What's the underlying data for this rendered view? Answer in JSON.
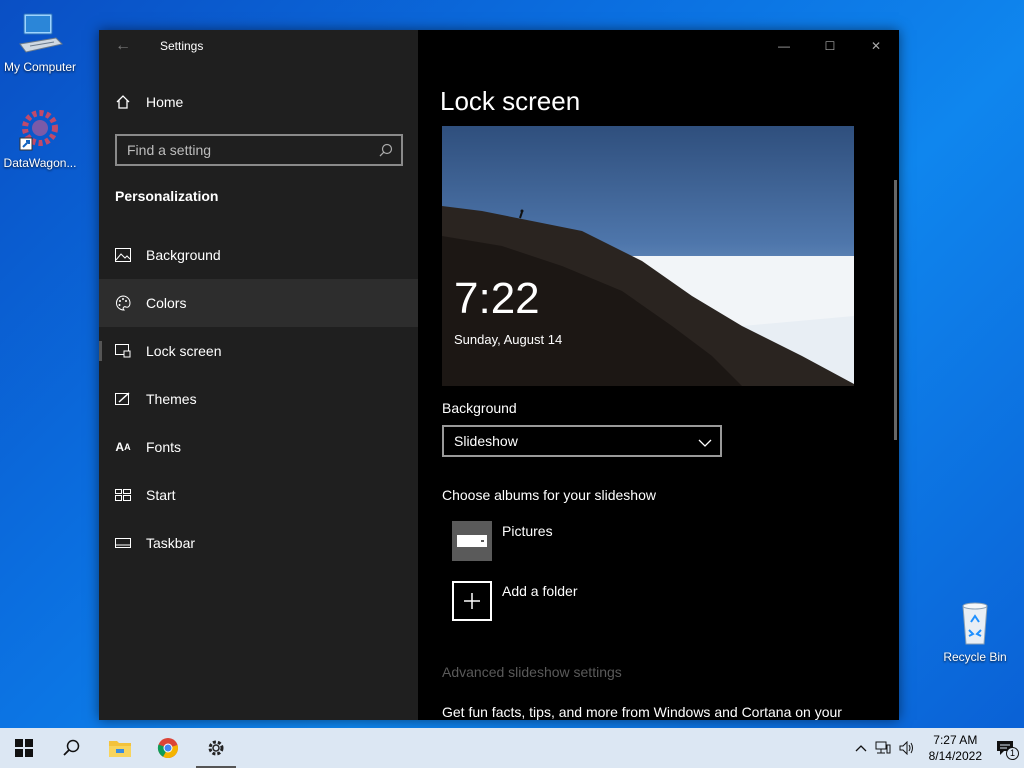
{
  "desktop": {
    "icons": [
      {
        "label": "My Computer"
      },
      {
        "label": "DataWagon..."
      },
      {
        "label": "Recycle Bin"
      }
    ]
  },
  "window": {
    "app_title": "Settings",
    "home_label": "Home",
    "search_placeholder": "Find a setting",
    "section_title": "Personalization",
    "nav": [
      {
        "label": "Background",
        "icon": "image-icon"
      },
      {
        "label": "Colors",
        "icon": "palette-icon"
      },
      {
        "label": "Lock screen",
        "icon": "lock-screen-icon"
      },
      {
        "label": "Themes",
        "icon": "themes-icon"
      },
      {
        "label": "Fonts",
        "icon": "fonts-icon"
      },
      {
        "label": "Start",
        "icon": "start-icon"
      },
      {
        "label": "Taskbar",
        "icon": "taskbar-icon"
      }
    ],
    "page_title": "Lock screen",
    "preview": {
      "time": "7:22",
      "date": "Sunday, August 14"
    },
    "background_label": "Background",
    "background_value": "Slideshow",
    "albums_label": "Choose albums for your slideshow",
    "albums": [
      {
        "label": "Pictures"
      },
      {
        "label": "Add a folder"
      }
    ],
    "advanced_link": "Advanced slideshow settings",
    "facts_text": "Get fun facts, tips, and more from Windows and Cortana on your"
  },
  "taskbar": {
    "time": "7:27 AM",
    "date": "8/14/2022",
    "notifications_count": "1"
  },
  "colors": {
    "accent": "#0078d7",
    "window_left_bg": "#1f1f1f",
    "window_right_bg": "#000000",
    "taskbar_bg": "#dce7f3"
  }
}
